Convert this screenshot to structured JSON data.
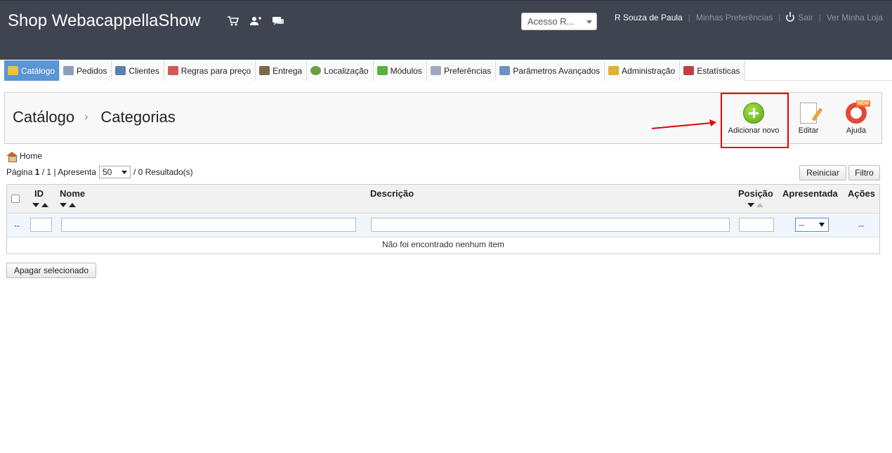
{
  "header": {
    "shop_title": "Shop WebacappellaShow",
    "access_select": "Acesso R...",
    "user_name": "R Souza de Paula",
    "preferences_link": "Minhas Preferências",
    "logout_link": "Sair",
    "view_store_link": "Ver Minha Loja"
  },
  "tabs": [
    {
      "label": "Catálogo",
      "color": "#f0c040"
    },
    {
      "label": "Pedidos",
      "color": "#8aa0b8"
    },
    {
      "label": "Clientes",
      "color": "#5a7fb0"
    },
    {
      "label": "Regras para preço",
      "color": "#d05a5a"
    },
    {
      "label": "Entrega",
      "color": "#7a6a4a"
    },
    {
      "label": "Localização",
      "color": "#6aa040"
    },
    {
      "label": "Módulos",
      "color": "#5ab040"
    },
    {
      "label": "Preferências",
      "color": "#a0a8c0"
    },
    {
      "label": "Parâmetros Avançados",
      "color": "#7090c0"
    },
    {
      "label": "Administração",
      "color": "#e0b030"
    },
    {
      "label": "Estatísticas",
      "color": "#c04040"
    }
  ],
  "breadcrumb": {
    "section": "Catálogo",
    "page": "Categorias"
  },
  "toolbar": {
    "add_label": "Adicionar novo",
    "edit_label": "Editar",
    "help_label": "Ajuda",
    "help_badge": "NEW"
  },
  "nav": {
    "home": "Home"
  },
  "paging": {
    "page_word": "Página",
    "current": "1",
    "total": "/ 1",
    "show_word": "| Apresenta",
    "per_page": "50",
    "results": "/ 0 Resultado(s)"
  },
  "buttons": {
    "reset": "Reiniciar",
    "filter": "Filtro",
    "delete_selected": "Apagar selecionado"
  },
  "table": {
    "columns": {
      "id": "ID",
      "name": "Nome",
      "description": "Descrição",
      "position": "Posição",
      "displayed": "Apresentada",
      "actions": "Ações"
    },
    "filter_dash_left": "--",
    "filter_displayed_value": "--",
    "filter_dash_right": "--",
    "empty_message": "Não foi encontrado nenhum item"
  }
}
